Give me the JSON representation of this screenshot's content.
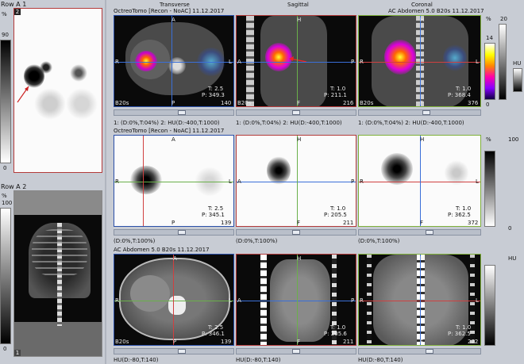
{
  "left": {
    "row_a1_label": "Row A 1",
    "row_a1_index": "2",
    "row_a1_pct": "%",
    "row_a1_top": "90",
    "row_a1_bottom": "0",
    "row_a2_label": "Row A 2",
    "row_a2_pct": "%",
    "row_a2_top": "100",
    "row_a2_bottom": "0",
    "row_a2_index": "1"
  },
  "header": {
    "series_top": "OctreoTomo [Recon - NoAC] 11.12.2017",
    "transverse": "Transverse",
    "sagittal": "Sagittal",
    "coronal": "Coronal",
    "series_ct": "AC Abdomen 5.0 B20s 11.12.2017"
  },
  "fusion_row": {
    "p1": {
      "t": "T: 2.5",
      "p": "P: 349.3",
      "slice": "140",
      "kernel": "B20s"
    },
    "p2": {
      "t": "T: 1.0",
      "p": "P: 211.1",
      "slice": "216",
      "kernel": "B20s"
    },
    "p3": {
      "t": "T: 1.0",
      "p": "P: 368.4",
      "slice": "376",
      "kernel": "B20s"
    },
    "wl_label": "1: (D:0%,T:04%)   2: HU(D:-400,T:1000)"
  },
  "spect_row": {
    "series": "OctreoTomo [Recon - NoAC] 11.12.2017",
    "p1": {
      "t": "T: 2.5",
      "p": "P: 345.1",
      "slice": "139"
    },
    "p2": {
      "t": "T: 1.0",
      "p": "P: 205.5",
      "slice": "211"
    },
    "p3": {
      "t": "T: 1.0",
      "p": "P: 362.5",
      "slice": "372"
    },
    "wl_label": "(D:0%,T:100%)",
    "pct": "%",
    "scale_top": "100",
    "scale_bottom": "0"
  },
  "ct_row": {
    "series": "AC Abdomen 5.0 B20s 11.12.2017",
    "p1": {
      "t": "T: 2.5",
      "p": "P: 346.1",
      "slice": "139",
      "kernel": "B20s"
    },
    "p2": {
      "t": "T: 1.0",
      "p": "P: 205.6",
      "slice": "211"
    },
    "p3": {
      "t": "T: 1.0",
      "p": "P: 362.5",
      "slice": "272"
    },
    "wl_label": "HU(D:-80,T:140)",
    "unit": "HU"
  },
  "fusion_scale": {
    "pct": "%",
    "top": "20",
    "mid": "14",
    "bottom": "0",
    "hu": "HU"
  },
  "orient": {
    "A": "A",
    "P": "P",
    "R": "R",
    "L": "L",
    "H": "H",
    "F": "F"
  }
}
